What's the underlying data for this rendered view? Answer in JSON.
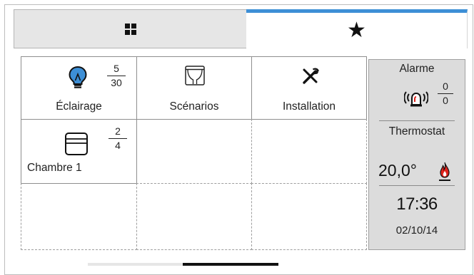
{
  "tabs": [
    {
      "name": "tab-rooms",
      "icon": "grid-icon",
      "selected": false
    },
    {
      "name": "tab-favorites",
      "icon": "star-icon",
      "symbol": "★",
      "selected": true
    }
  ],
  "tiles": {
    "lighting": {
      "label": "Éclairage",
      "icon": "light-bulb-icon",
      "on": "5",
      "total": "30"
    },
    "scenarios": {
      "label": "Scénarios",
      "icon": "curtain-icon"
    },
    "installation": {
      "label": "Installation",
      "icon": "tools-icon"
    },
    "bedroom": {
      "label": "Chambre 1",
      "icon": "shutter-icon",
      "open": "2",
      "total": "4"
    }
  },
  "status_panel": {
    "alarm": {
      "title": "Alarme",
      "active": "0",
      "total": "0",
      "icon": "alarm-siren-icon"
    },
    "thermostat": {
      "title": "Thermostat",
      "temperature": "20,0°",
      "icon": "flame-icon",
      "flame_color": "#e0221b"
    },
    "time": "17:36",
    "date": "02/10/14"
  },
  "pager": {
    "pages": 2,
    "current": 2
  },
  "colors": {
    "accent": "#3d8fd6",
    "bulb": "#3d8fd6",
    "panel": "#dcdcdc",
    "tab_inactive": "#e6e6e6"
  }
}
